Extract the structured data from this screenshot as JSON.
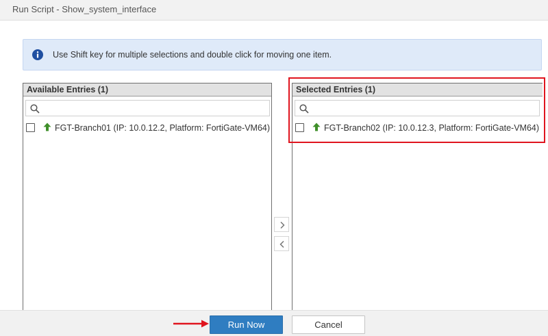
{
  "window": {
    "title": "Run Script - Show_system_interface"
  },
  "info_banner": {
    "icon": "info-circle-icon",
    "text": "Use Shift key for multiple selections and double click for moving one item.",
    "background": "#dfeaf9",
    "icon_color": "#1f4fa1"
  },
  "available_panel": {
    "header": "Available Entries (1)",
    "search_placeholder": "",
    "entries": [
      {
        "checked": false,
        "icon": "up-arrow-icon",
        "label": "FGT-Branch01 (IP: 10.0.12.2, Platform: FortiGate-VM64)"
      }
    ]
  },
  "selected_panel": {
    "header": "Selected Entries (1)",
    "search_placeholder": "",
    "entries": [
      {
        "checked": false,
        "icon": "up-arrow-icon",
        "label": "FGT-Branch02 (IP: 10.0.12.3, Platform: FortiGate-VM64)"
      }
    ]
  },
  "move_buttons": {
    "move_right_icon": "chevron-right-icon",
    "move_left_icon": "chevron-left-icon"
  },
  "footer": {
    "run_label": "Run Now",
    "cancel_label": "Cancel"
  },
  "colors": {
    "primary_button": "#2f7dc1",
    "highlight": "#e0141e",
    "status_up": "#3f8f2a"
  }
}
